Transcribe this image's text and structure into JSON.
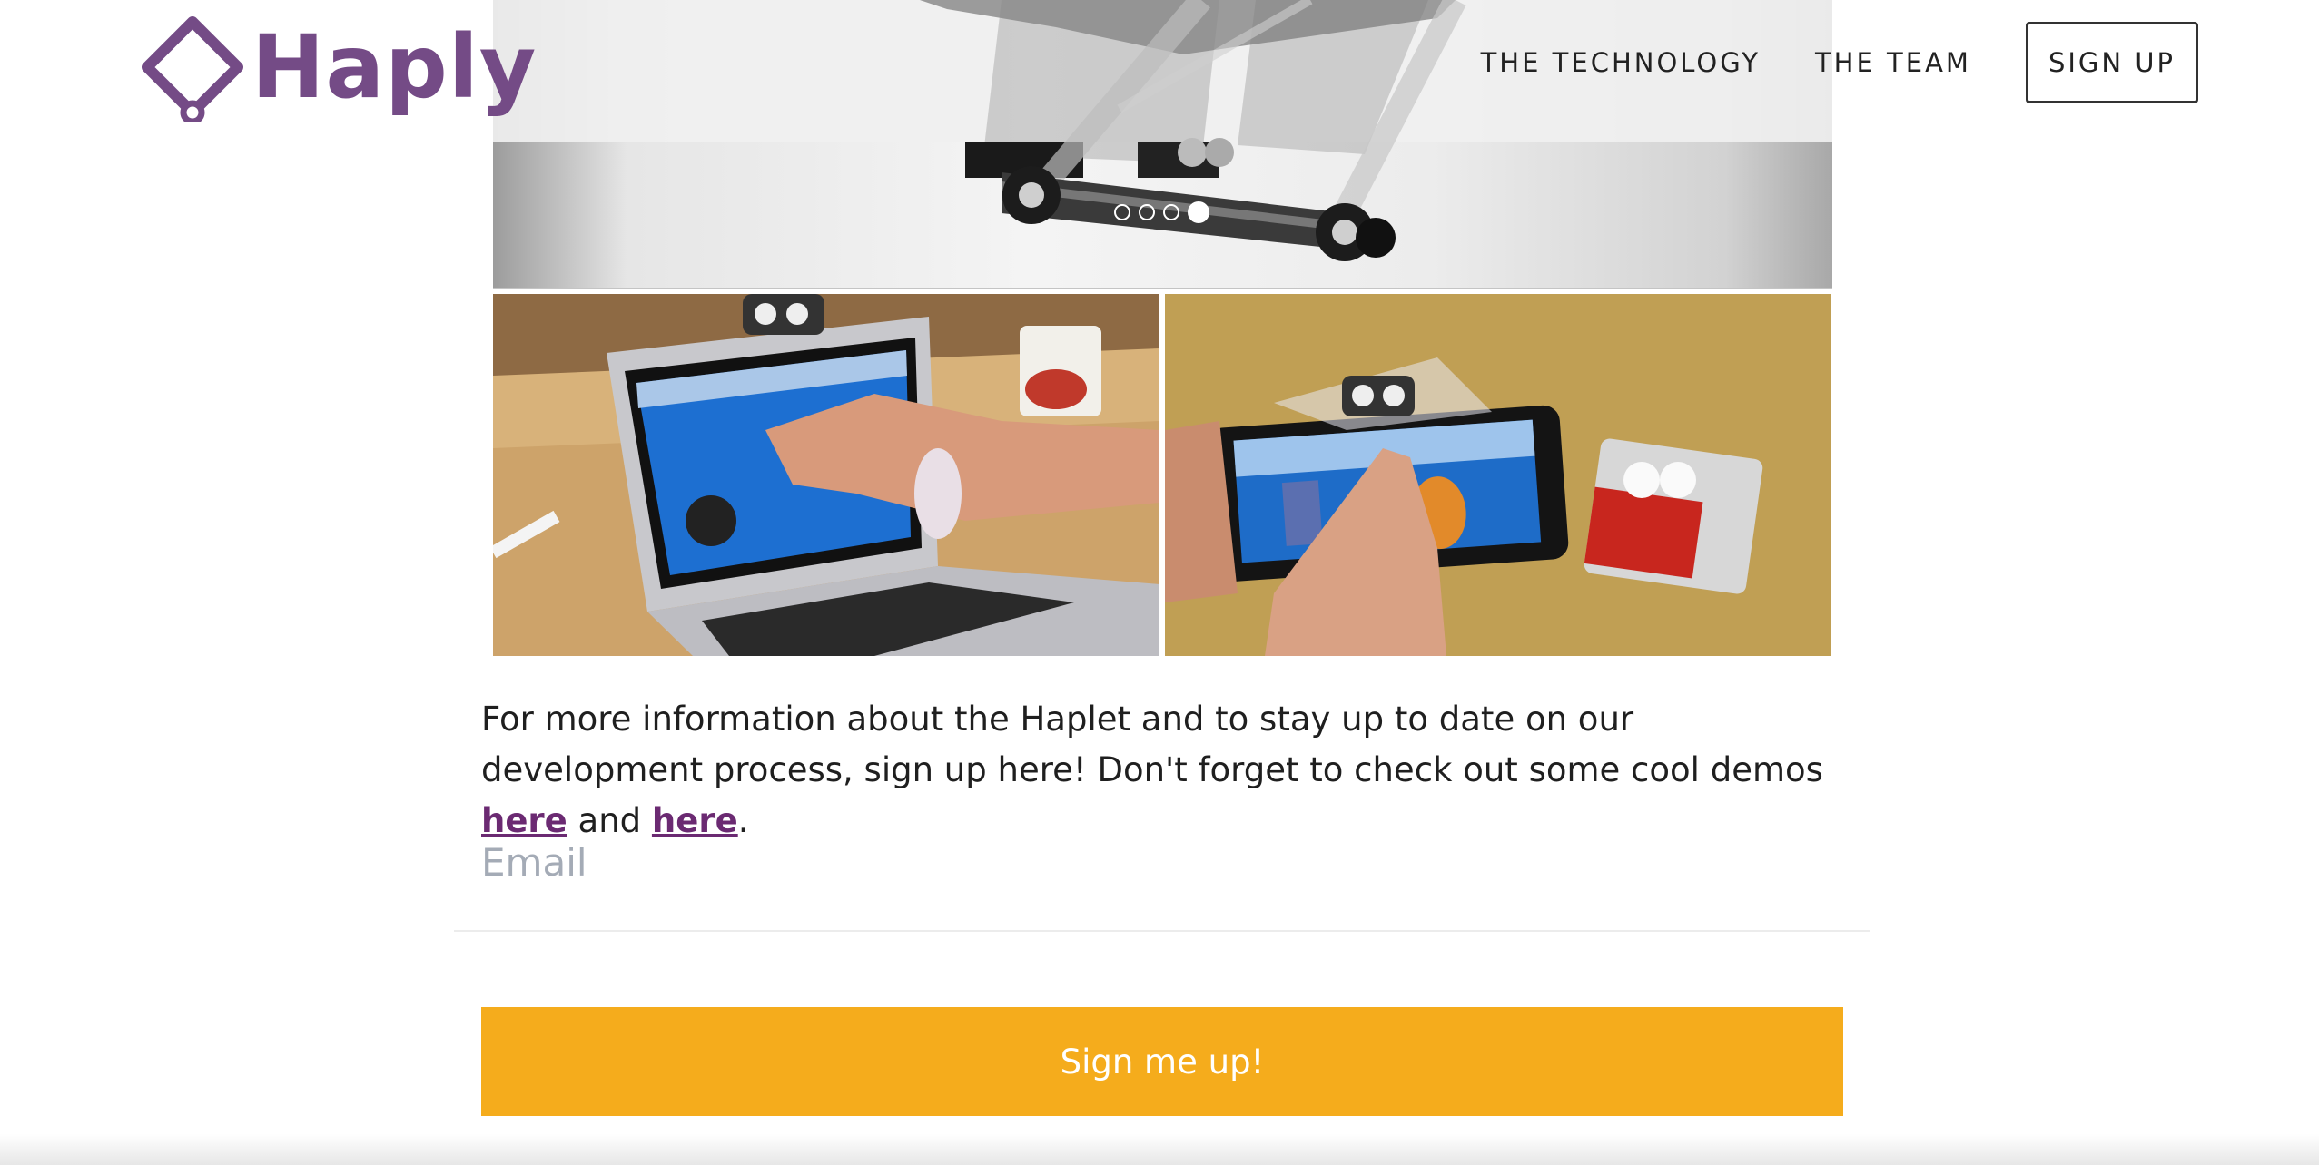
{
  "brand": {
    "name": "Haply",
    "color": "#744b86"
  },
  "nav": {
    "items": [
      {
        "label": "THE TECHNOLOGY"
      },
      {
        "label": "THE TEAM"
      }
    ],
    "signup_label": "SIGN UP"
  },
  "slider": {
    "dot_count": 4,
    "active_index": 3
  },
  "content": {
    "paragraph_start": "For more information about the Haplet and to stay up to date on our development process, sign up here! Don't forget to check out some cool demos ",
    "link1_label": "here",
    "between": " and ",
    "link2_label": "here",
    "end": "."
  },
  "form": {
    "email_placeholder": "Email",
    "email_value": "",
    "submit_label": "Sign me up!"
  },
  "colors": {
    "accent": "#f5ac1c",
    "link": "#6b2a72",
    "placeholder": "#a4abb6"
  }
}
